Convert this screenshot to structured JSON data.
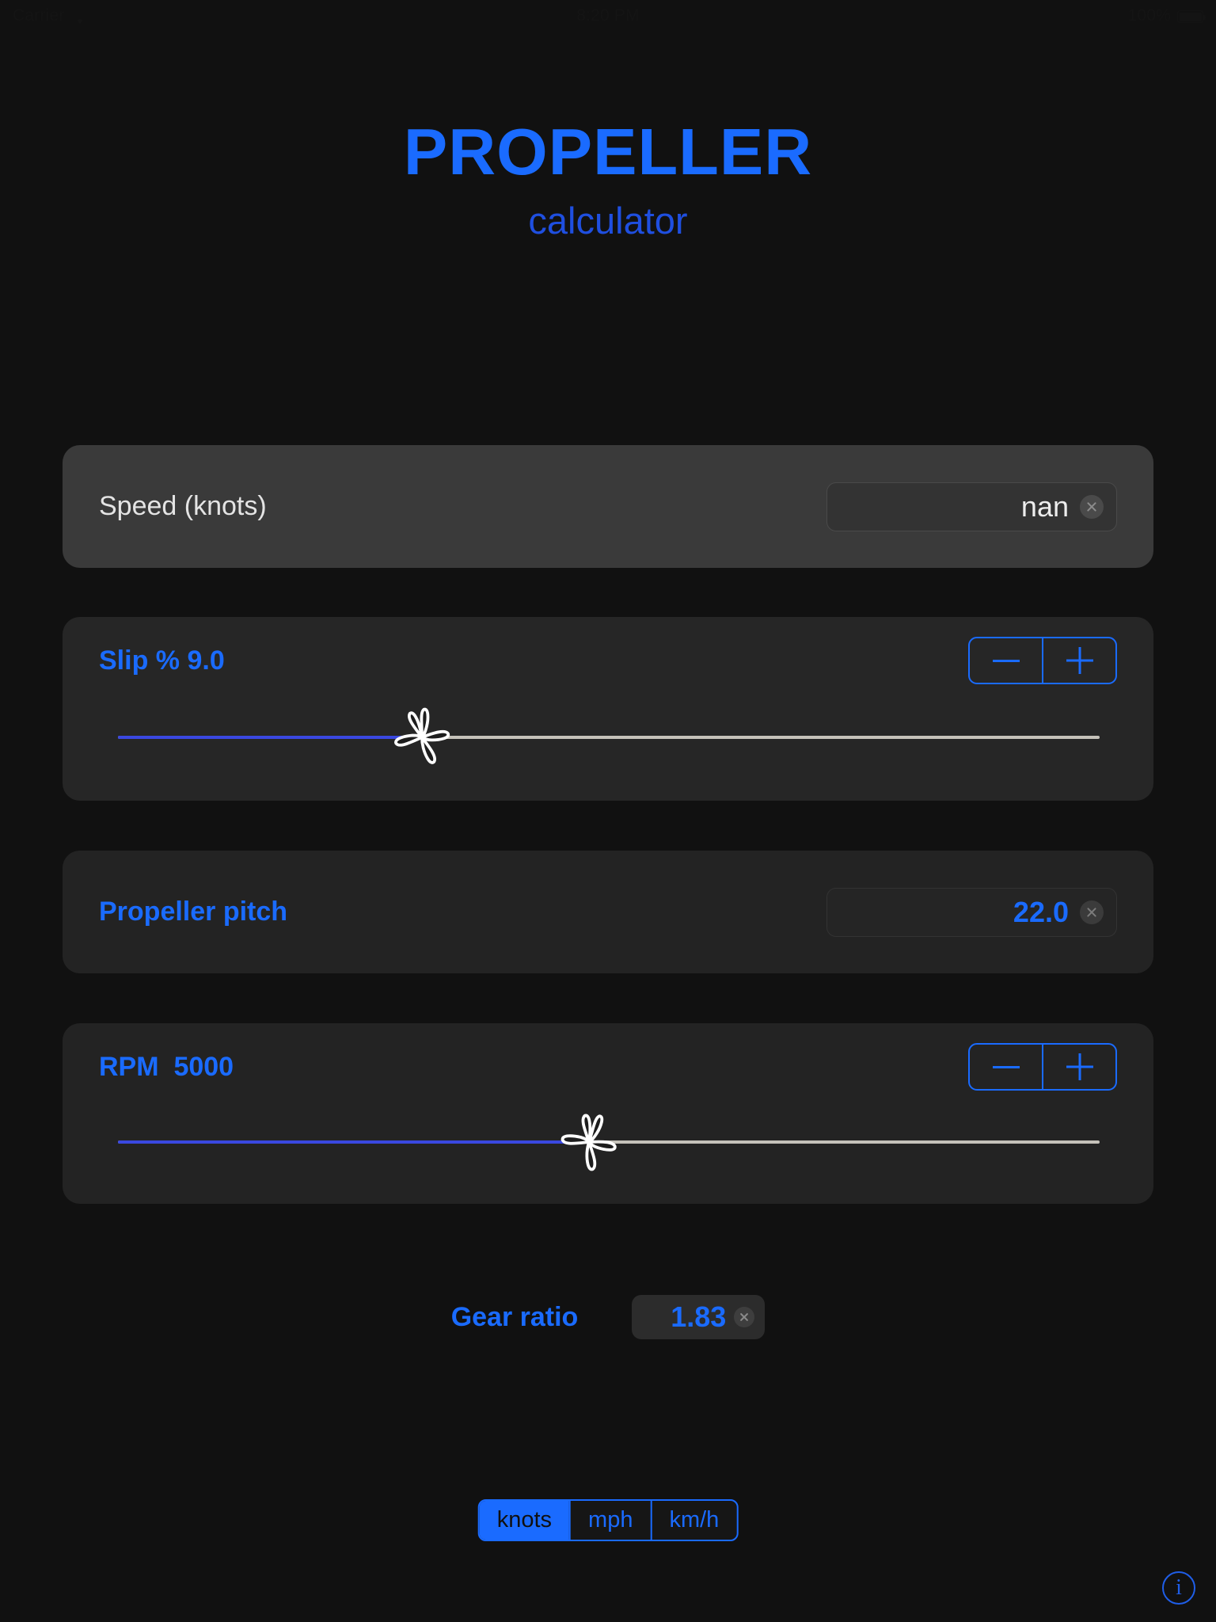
{
  "status_bar": {
    "carrier": "Carrier",
    "time": "8:20 PM",
    "battery": "100%",
    "wifi_icon": "wifi-icon",
    "battery_icon": "battery-full-icon"
  },
  "header": {
    "title": "PROPELLER",
    "subtitle": "calculator",
    "title_color": "#1a6bff",
    "subtitle_color": "#1f4fe0"
  },
  "speed": {
    "label": "Speed (knots)",
    "value": "nan",
    "clear_icon": "clear-circle-icon"
  },
  "slip": {
    "label": "Slip % 9.0",
    "value": 9.0,
    "percent": 31,
    "minus_label": "−",
    "plus_label": "+"
  },
  "pitch": {
    "label": "Propeller pitch",
    "value": "22.0",
    "clear_icon": "clear-circle-icon"
  },
  "rpm": {
    "label": "RPM  5000",
    "value": 5000,
    "percent": 48,
    "minus_label": "−",
    "plus_label": "+"
  },
  "gear_ratio": {
    "label": "Gear ratio",
    "value": "1.83",
    "clear_icon": "clear-circle-icon"
  },
  "units": {
    "options": [
      {
        "label": "knots",
        "selected": true
      },
      {
        "label": "mph",
        "selected": false
      },
      {
        "label": "km/h",
        "selected": false
      }
    ]
  },
  "info": {
    "label": "i",
    "icon": "info-circle-icon"
  },
  "colors": {
    "accent": "#1a6bff",
    "background": "#111111",
    "card_light": "#3a3a3a",
    "card_dark": "#232323",
    "track": "#c5c2ba",
    "track_fill": "#3a48e0"
  }
}
